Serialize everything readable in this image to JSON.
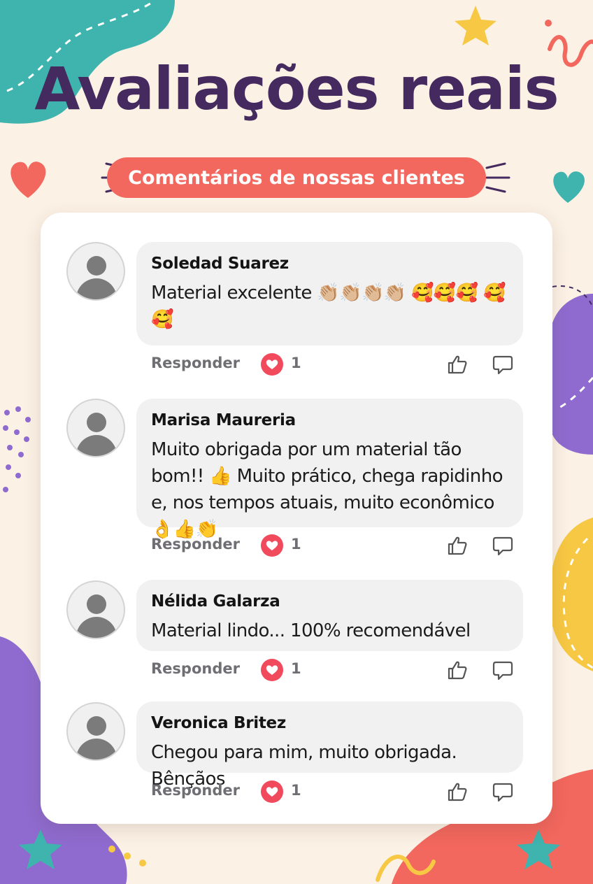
{
  "header": {
    "title": "Avaliações reais",
    "subtitle": "Comentários de nossas clientes"
  },
  "colors": {
    "background": "#fbf1e4",
    "title": "#452a5f",
    "subtitle_pill": "#f2675e",
    "heart_reaction": "#f24a5d",
    "bubble": "#f1f1f2",
    "card": "#ffffff"
  },
  "comments": [
    {
      "author": "Soledad Suarez",
      "text": "Material excelente 👏🏼👏🏼👏🏼👏🏼 🥰🥰🥰 🥰🥰",
      "reply_label": "Responder",
      "reactions": "1"
    },
    {
      "author": "Marisa Maureria",
      "text": "Muito obrigada por um material tão bom!! 👍 Muito prático, chega rapidinho e, nos tempos atuais, muito econômico 👌👍👏",
      "reply_label": "Responder",
      "reactions": "1"
    },
    {
      "author": "Nélida Galarza",
      "text": "Material lindo... 100% recomendável",
      "reply_label": "Responder",
      "reactions": "1"
    },
    {
      "author": "Veronica Britez",
      "text": "Chegou para mim, muito obrigada. Bênçãos",
      "reply_label": "Responder",
      "reactions": "1"
    }
  ],
  "icons": {
    "avatar": "default-avatar-icon",
    "reaction": "heart-icon",
    "like": "thumbs-up-icon",
    "comment": "chat-bubble-icon"
  }
}
